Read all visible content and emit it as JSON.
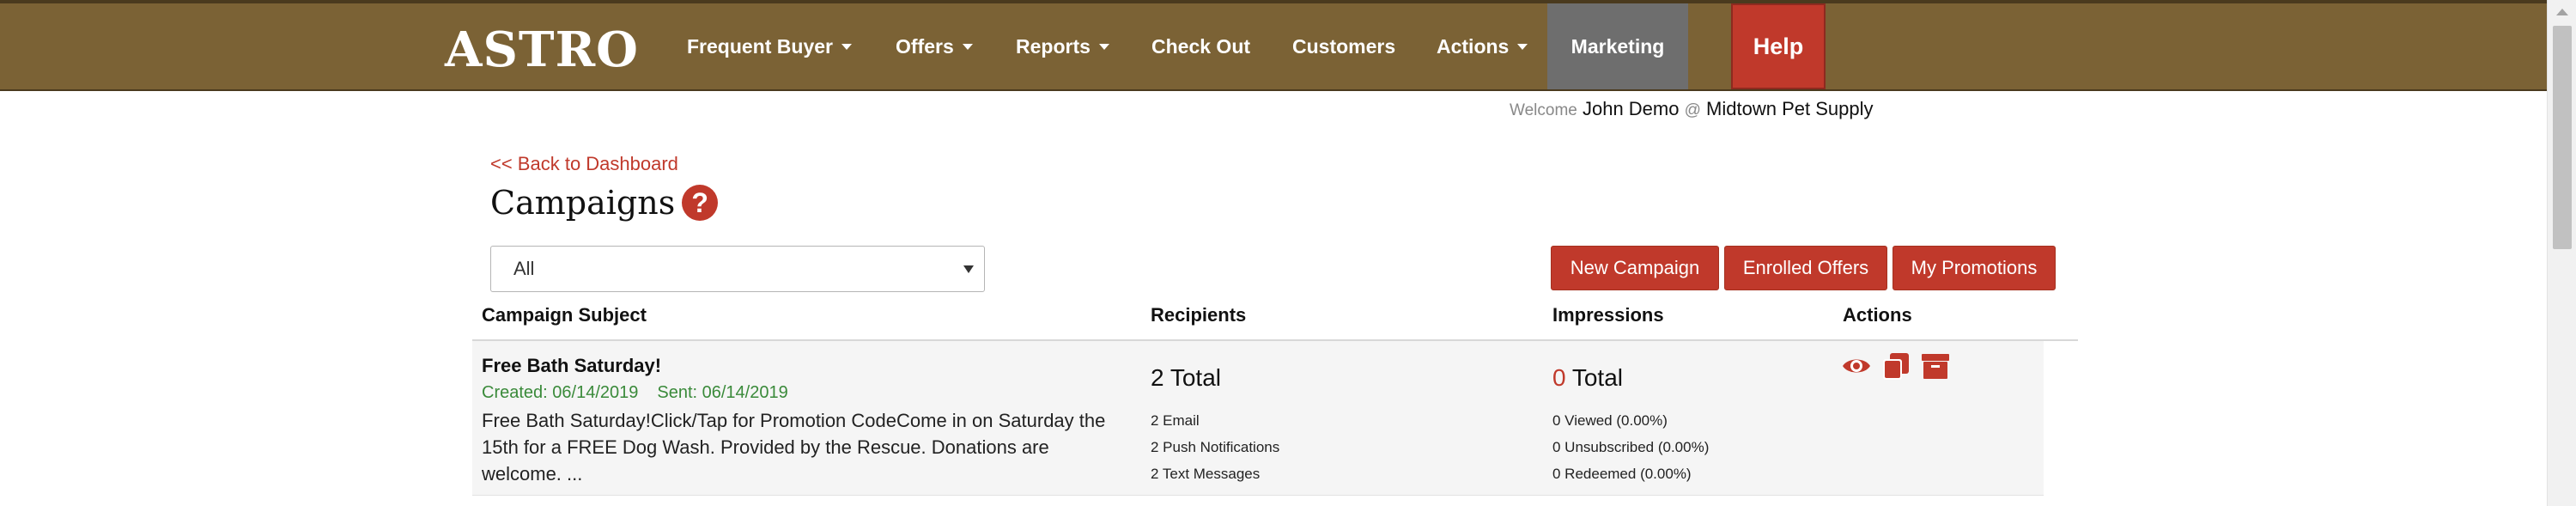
{
  "nav": {
    "logo": "ASTRO",
    "items": [
      {
        "label": "Frequent Buyer",
        "dropdown": true
      },
      {
        "label": "Offers",
        "dropdown": true
      },
      {
        "label": "Reports",
        "dropdown": true
      },
      {
        "label": "Check Out",
        "dropdown": false
      },
      {
        "label": "Customers",
        "dropdown": false
      },
      {
        "label": "Actions",
        "dropdown": true
      }
    ],
    "marketing": "Marketing",
    "help": "Help"
  },
  "welcome": {
    "prefix": "Welcome",
    "user": "John Demo",
    "at": "@",
    "store": "Midtown Pet Supply"
  },
  "back_link": "<< Back to Dashboard",
  "page_title": "Campaigns",
  "help_glyph": "?",
  "filter": {
    "selected": "All"
  },
  "buttons": {
    "new_campaign": "New Campaign",
    "enrolled_offers": "Enrolled Offers",
    "my_promotions": "My Promotions"
  },
  "table": {
    "headers": {
      "subject": "Campaign Subject",
      "recipients": "Recipients",
      "impressions": "Impressions",
      "actions": "Actions"
    },
    "rows": [
      {
        "subject": "Free Bath Saturday!",
        "created": "Created: 06/14/2019",
        "sent": "Sent: 06/14/2019",
        "body": "Free Bath Saturday!Click/Tap for Promotion CodeCome in on Saturday the 15th for a FREE Dog Wash. Provided by the Rescue. Donations are welcome. ...",
        "recipients_total": "2 Total",
        "recipients_email": "2 Email",
        "recipients_push": "2 Push Notifications",
        "recipients_text": "2 Text Messages",
        "impressions_count": "0",
        "impressions_label": " Total",
        "viewed": "0 Viewed (0.00%)",
        "unsubscribed": "0 Unsubscribed (0.00%)",
        "redeemed": "0 Redeemed (0.00%)",
        "actions": [
          "eye-icon",
          "copy-icon",
          "archive-icon"
        ]
      }
    ]
  },
  "colors": {
    "navbar": "#7b6235",
    "accent": "#c0392b",
    "marketing_active": "#6e6e6e",
    "meta_green": "#3a8a3a"
  }
}
